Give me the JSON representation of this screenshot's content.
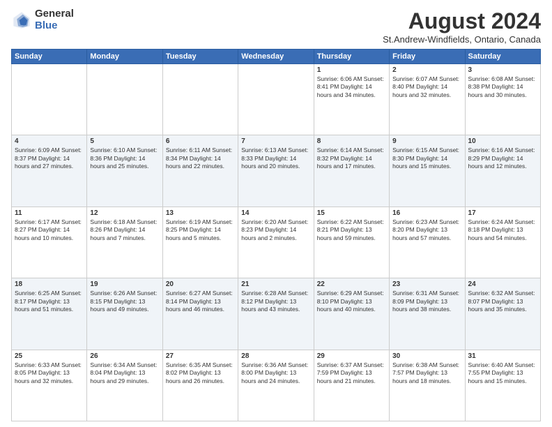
{
  "logo": {
    "general": "General",
    "blue": "Blue"
  },
  "title": {
    "month": "August 2024",
    "location": "St.Andrew-Windfields, Ontario, Canada"
  },
  "days_of_week": [
    "Sunday",
    "Monday",
    "Tuesday",
    "Wednesday",
    "Thursday",
    "Friday",
    "Saturday"
  ],
  "weeks": [
    [
      {
        "num": "",
        "info": ""
      },
      {
        "num": "",
        "info": ""
      },
      {
        "num": "",
        "info": ""
      },
      {
        "num": "",
        "info": ""
      },
      {
        "num": "1",
        "info": "Sunrise: 6:06 AM\nSunset: 8:41 PM\nDaylight: 14 hours\nand 34 minutes."
      },
      {
        "num": "2",
        "info": "Sunrise: 6:07 AM\nSunset: 8:40 PM\nDaylight: 14 hours\nand 32 minutes."
      },
      {
        "num": "3",
        "info": "Sunrise: 6:08 AM\nSunset: 8:38 PM\nDaylight: 14 hours\nand 30 minutes."
      }
    ],
    [
      {
        "num": "4",
        "info": "Sunrise: 6:09 AM\nSunset: 8:37 PM\nDaylight: 14 hours\nand 27 minutes."
      },
      {
        "num": "5",
        "info": "Sunrise: 6:10 AM\nSunset: 8:36 PM\nDaylight: 14 hours\nand 25 minutes."
      },
      {
        "num": "6",
        "info": "Sunrise: 6:11 AM\nSunset: 8:34 PM\nDaylight: 14 hours\nand 22 minutes."
      },
      {
        "num": "7",
        "info": "Sunrise: 6:13 AM\nSunset: 8:33 PM\nDaylight: 14 hours\nand 20 minutes."
      },
      {
        "num": "8",
        "info": "Sunrise: 6:14 AM\nSunset: 8:32 PM\nDaylight: 14 hours\nand 17 minutes."
      },
      {
        "num": "9",
        "info": "Sunrise: 6:15 AM\nSunset: 8:30 PM\nDaylight: 14 hours\nand 15 minutes."
      },
      {
        "num": "10",
        "info": "Sunrise: 6:16 AM\nSunset: 8:29 PM\nDaylight: 14 hours\nand 12 minutes."
      }
    ],
    [
      {
        "num": "11",
        "info": "Sunrise: 6:17 AM\nSunset: 8:27 PM\nDaylight: 14 hours\nand 10 minutes."
      },
      {
        "num": "12",
        "info": "Sunrise: 6:18 AM\nSunset: 8:26 PM\nDaylight: 14 hours\nand 7 minutes."
      },
      {
        "num": "13",
        "info": "Sunrise: 6:19 AM\nSunset: 8:25 PM\nDaylight: 14 hours\nand 5 minutes."
      },
      {
        "num": "14",
        "info": "Sunrise: 6:20 AM\nSunset: 8:23 PM\nDaylight: 14 hours\nand 2 minutes."
      },
      {
        "num": "15",
        "info": "Sunrise: 6:22 AM\nSunset: 8:21 PM\nDaylight: 13 hours\nand 59 minutes."
      },
      {
        "num": "16",
        "info": "Sunrise: 6:23 AM\nSunset: 8:20 PM\nDaylight: 13 hours\nand 57 minutes."
      },
      {
        "num": "17",
        "info": "Sunrise: 6:24 AM\nSunset: 8:18 PM\nDaylight: 13 hours\nand 54 minutes."
      }
    ],
    [
      {
        "num": "18",
        "info": "Sunrise: 6:25 AM\nSunset: 8:17 PM\nDaylight: 13 hours\nand 51 minutes."
      },
      {
        "num": "19",
        "info": "Sunrise: 6:26 AM\nSunset: 8:15 PM\nDaylight: 13 hours\nand 49 minutes."
      },
      {
        "num": "20",
        "info": "Sunrise: 6:27 AM\nSunset: 8:14 PM\nDaylight: 13 hours\nand 46 minutes."
      },
      {
        "num": "21",
        "info": "Sunrise: 6:28 AM\nSunset: 8:12 PM\nDaylight: 13 hours\nand 43 minutes."
      },
      {
        "num": "22",
        "info": "Sunrise: 6:29 AM\nSunset: 8:10 PM\nDaylight: 13 hours\nand 40 minutes."
      },
      {
        "num": "23",
        "info": "Sunrise: 6:31 AM\nSunset: 8:09 PM\nDaylight: 13 hours\nand 38 minutes."
      },
      {
        "num": "24",
        "info": "Sunrise: 6:32 AM\nSunset: 8:07 PM\nDaylight: 13 hours\nand 35 minutes."
      }
    ],
    [
      {
        "num": "25",
        "info": "Sunrise: 6:33 AM\nSunset: 8:05 PM\nDaylight: 13 hours\nand 32 minutes."
      },
      {
        "num": "26",
        "info": "Sunrise: 6:34 AM\nSunset: 8:04 PM\nDaylight: 13 hours\nand 29 minutes."
      },
      {
        "num": "27",
        "info": "Sunrise: 6:35 AM\nSunset: 8:02 PM\nDaylight: 13 hours\nand 26 minutes."
      },
      {
        "num": "28",
        "info": "Sunrise: 6:36 AM\nSunset: 8:00 PM\nDaylight: 13 hours\nand 24 minutes."
      },
      {
        "num": "29",
        "info": "Sunrise: 6:37 AM\nSunset: 7:59 PM\nDaylight: 13 hours\nand 21 minutes."
      },
      {
        "num": "30",
        "info": "Sunrise: 6:38 AM\nSunset: 7:57 PM\nDaylight: 13 hours\nand 18 minutes."
      },
      {
        "num": "31",
        "info": "Sunrise: 6:40 AM\nSunset: 7:55 PM\nDaylight: 13 hours\nand 15 minutes."
      }
    ]
  ]
}
